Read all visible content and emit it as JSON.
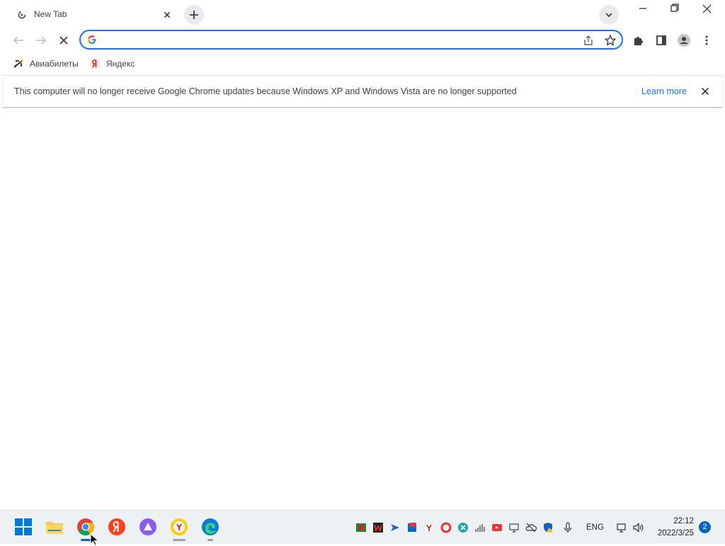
{
  "tab": {
    "title": "New Tab"
  },
  "omnibox": {
    "value": "",
    "placeholder": ""
  },
  "bookmarks": [
    {
      "label": "Авиабилеты",
      "icon": "airplane-icon"
    },
    {
      "label": "Яндекс",
      "icon": "yandex-icon"
    }
  ],
  "infobar": {
    "message": "This computer will no longer receive Google Chrome updates because Windows XP and Windows Vista are no longer supported",
    "link_label": "Learn more"
  },
  "taskbar": {
    "pinned": [
      "windows-start-icon",
      "file-explorer-icon",
      "chrome-icon",
      "yandex-browser-icon",
      "alice-icon",
      "yandex-browser-lite-icon",
      "edge-icon"
    ],
    "language": "ENG",
    "time": "22:12",
    "date": "2022/3/25",
    "notification_count": "2"
  },
  "colors": {
    "accent": "#1a73e8",
    "taskbar": "#eef1f4",
    "notification": "#0067c0"
  }
}
